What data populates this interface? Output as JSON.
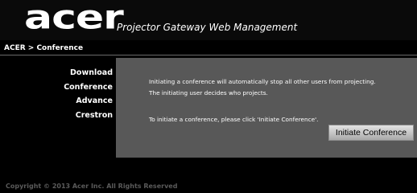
{
  "header": {
    "logo_text": "acer",
    "title": "Projector Gateway Web Management"
  },
  "breadcrumb": "ACER > Conference",
  "sidebar": {
    "items": [
      {
        "label": "Download"
      },
      {
        "label": "Conference"
      },
      {
        "label": "Advance"
      },
      {
        "label": "Crestron"
      }
    ]
  },
  "main": {
    "line1": "Initiating a conference will automatically stop all other users from projecting.",
    "line2": "The initiating user decides who projects.",
    "line3": "To initiate a conference, please click 'Initiate Conference'.",
    "button_label": "Initiate Conference"
  },
  "footer": "Copyright © 2013 Acer Inc. All Rights Reserved",
  "colors": {
    "background": "#000000",
    "panel": "#585858",
    "text": "#ffffff",
    "footer_text": "#5a5a5a"
  }
}
